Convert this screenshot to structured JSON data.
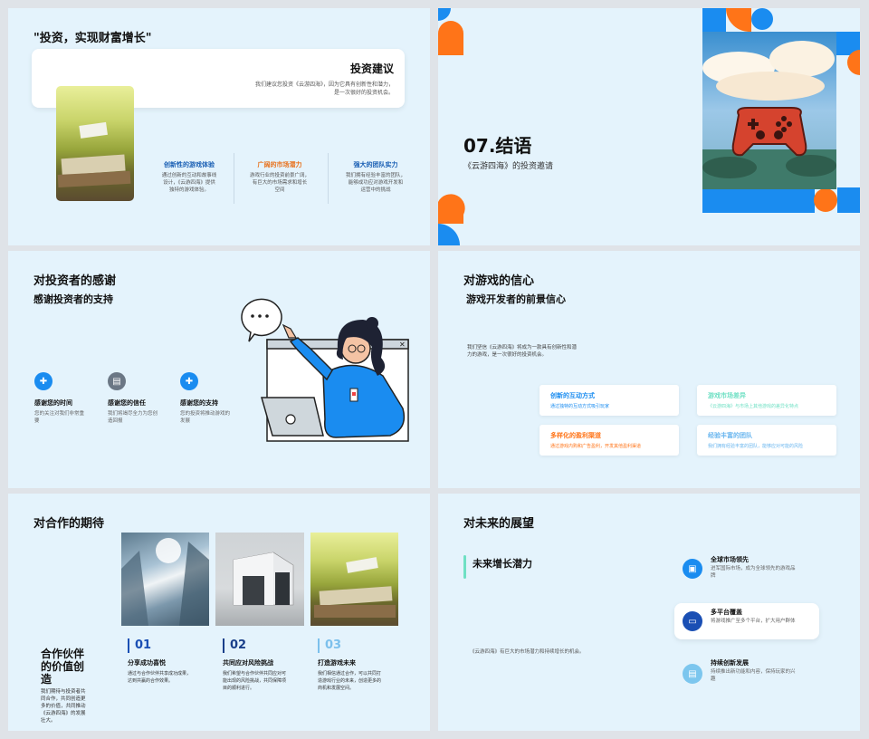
{
  "slide1": {
    "title": "\"投资，实现财富增长\"",
    "card_heading": "投资建议",
    "card_text_1": "我们建议您投资《云游四海》，因为它具有创新性和潜力，",
    "card_text_2": "是一次很好的投资机会。",
    "columns": [
      {
        "title": "创新性的游戏体验",
        "color": "#1a5fb4",
        "lines": [
          "通过创新的互动和故事线",
          "设计，《云游四海》提供",
          "独特的游戏体验。"
        ]
      },
      {
        "title": "广阔的市场潜力",
        "color": "#e8701a",
        "lines": [
          "游戏行业的投资前景广阔，",
          "有巨大的市场需求和增长",
          "空间"
        ]
      },
      {
        "title": "强大的团队实力",
        "color": "#1a5fb4",
        "lines": [
          "我们拥有经验丰富的团队，",
          "能够成功应对游戏开发和",
          "运营中的挑战"
        ]
      }
    ]
  },
  "slide2": {
    "title": "07.结语",
    "subtitle": "《云游四海》的投资邀请"
  },
  "slide3": {
    "title": "对投资者的感谢",
    "subtitle": "感谢投资者的支持",
    "items": [
      {
        "title": "感谢您的时间",
        "lines": [
          "您的关注对我们非常重",
          "要"
        ],
        "icon": "puzzle-icon",
        "color": "#1a8cf0"
      },
      {
        "title": "感谢您的信任",
        "lines": [
          "我们将竭尽全力为您创",
          "造回报"
        ],
        "icon": "clipboard-icon",
        "color": "#6b7785"
      },
      {
        "title": "感谢您的支持",
        "lines": [
          "您的投资将推动游戏的",
          "发展"
        ],
        "icon": "puzzle-icon",
        "color": "#1a8cf0"
      }
    ],
    "bubble_text": "• • •"
  },
  "slide4": {
    "title": "对游戏的信心",
    "subtitle": "游戏开发者的前景信心",
    "intro_1": "我们坚信《云游四海》将成为一款具有创新性和潜",
    "intro_2": "力的游戏，是一次很好的投资机会。",
    "cards": [
      {
        "title": "创新的互动方式",
        "desc": "通过独特的互动方式吸引玩家",
        "color": "#1a8cf0"
      },
      {
        "title": "游戏市场差异",
        "desc": "《云游四海》与市场上其他游戏的差异化特点",
        "color": "#6fe0c4"
      },
      {
        "title": "多样化的盈利渠道",
        "desc": "通过游戏内购和广告盈利，开发其他盈利渠道",
        "color": "#ff7418"
      },
      {
        "title": "经验丰富的团队",
        "desc": "我们拥有经验丰富的团队，能够应对可能的风险",
        "color": "#6ab6ef"
      }
    ]
  },
  "slide5": {
    "title": "对合作的期待",
    "side_title_1": "合作伙伴",
    "side_title_2": "的价值创",
    "side_title_3": "造",
    "side_lines": [
      "我们期待与投资者共",
      "同合作，共同创造更",
      "多的价值，共同推动",
      "《云游四海》的发展",
      "壮大。"
    ],
    "columns": [
      {
        "num": "01",
        "title": "分享成功喜悦",
        "lines": [
          "通过与合作伙伴共享成功成果，",
          "达到共赢的合作效果。"
        ],
        "num_color": "#1a4fb4"
      },
      {
        "num": "02",
        "title": "共同应对风险挑战",
        "lines": [
          "我们希望与合作伙伴共同应对可",
          "能出现的风险挑战，共同保障项",
          "目的顺利进行。"
        ],
        "num_color": "#1a3f8a"
      },
      {
        "num": "03",
        "title": "打造游戏未来",
        "lines": [
          "我们相信通过合作，可以共同打",
          "造游戏行业的未来，创造更多的",
          "商机和发展空间。"
        ],
        "num_color": "#7cc0ec"
      }
    ]
  },
  "slide6": {
    "title": "对未来的展望",
    "subtitle": "未来增长潜力",
    "body": "《云游四海》有巨大的市场潜力和持续增长的机会。",
    "features": [
      {
        "title": "全球市场领先",
        "lines": [
          "进军国际市场，成为全球领先的游戏品",
          "牌"
        ],
        "icon": "image-icon",
        "color": "#1a8cf0"
      },
      {
        "title": "多平台覆盖",
        "lines": [
          "将游戏推广至多个平台，扩大用户群体"
        ],
        "icon": "gamepad-icon",
        "color": "#1a4fb4"
      },
      {
        "title": "持续创新发展",
        "lines": [
          "持续推出新功能和内容，保持玩家的兴",
          "趣"
        ],
        "icon": "chat-icon",
        "color": "#7cc6ee"
      }
    ]
  }
}
